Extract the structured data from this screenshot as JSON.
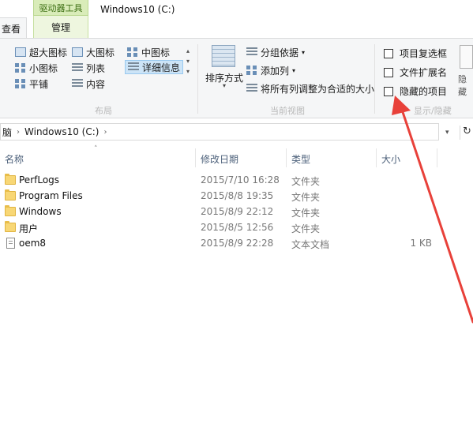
{
  "window": {
    "title": "Windows10 (C:)"
  },
  "tabs": {
    "context_group": "驱动器工具",
    "context_tab": "管理",
    "view_tab": "查看"
  },
  "ribbon": {
    "layout": {
      "items": [
        {
          "label": "超大图标"
        },
        {
          "label": "大图标"
        },
        {
          "label": "中图标"
        },
        {
          "label": "小图标"
        },
        {
          "label": "列表"
        },
        {
          "label": "详细信息"
        },
        {
          "label": "平铺"
        },
        {
          "label": "内容"
        }
      ],
      "selected": "详细信息",
      "group_label": "布局"
    },
    "current_view": {
      "sort_label": "排序方式",
      "group_by": "分组依据",
      "add_column": "添加列",
      "fit_columns": "将所有列调整为合适的大小",
      "group_label": "当前视图"
    },
    "show_hide": {
      "item_checkboxes": "项目复选框",
      "file_extensions": "文件扩展名",
      "hidden_items": "隐藏的项目",
      "group_label": "显示/隐藏",
      "hide_selected": "隐藏"
    }
  },
  "address": {
    "parent": "脑",
    "current": "Windows10 (C:)"
  },
  "columns": {
    "name": "名称",
    "date": "修改日期",
    "type": "类型",
    "size": "大小"
  },
  "files": [
    {
      "name": "PerfLogs",
      "date": "2015/7/10 16:28",
      "type": "文件夹",
      "size": "",
      "icon": "folder-icon"
    },
    {
      "name": "Program Files",
      "date": "2015/8/8 19:35",
      "type": "文件夹",
      "size": "",
      "icon": "folder-icon"
    },
    {
      "name": "Windows",
      "date": "2015/8/9 22:12",
      "type": "文件夹",
      "size": "",
      "icon": "folder-icon"
    },
    {
      "name": "用户",
      "date": "2015/8/5 12:56",
      "type": "文件夹",
      "size": "",
      "icon": "folder-icon"
    },
    {
      "name": "oem8",
      "date": "2015/8/9 22:28",
      "type": "文本文档",
      "size": "1 KB",
      "icon": "text-file-icon"
    }
  ],
  "colors": {
    "context_green": "#d9ecb9",
    "selection_blue": "#cce4f7",
    "annotation_red": "#e8413a"
  }
}
